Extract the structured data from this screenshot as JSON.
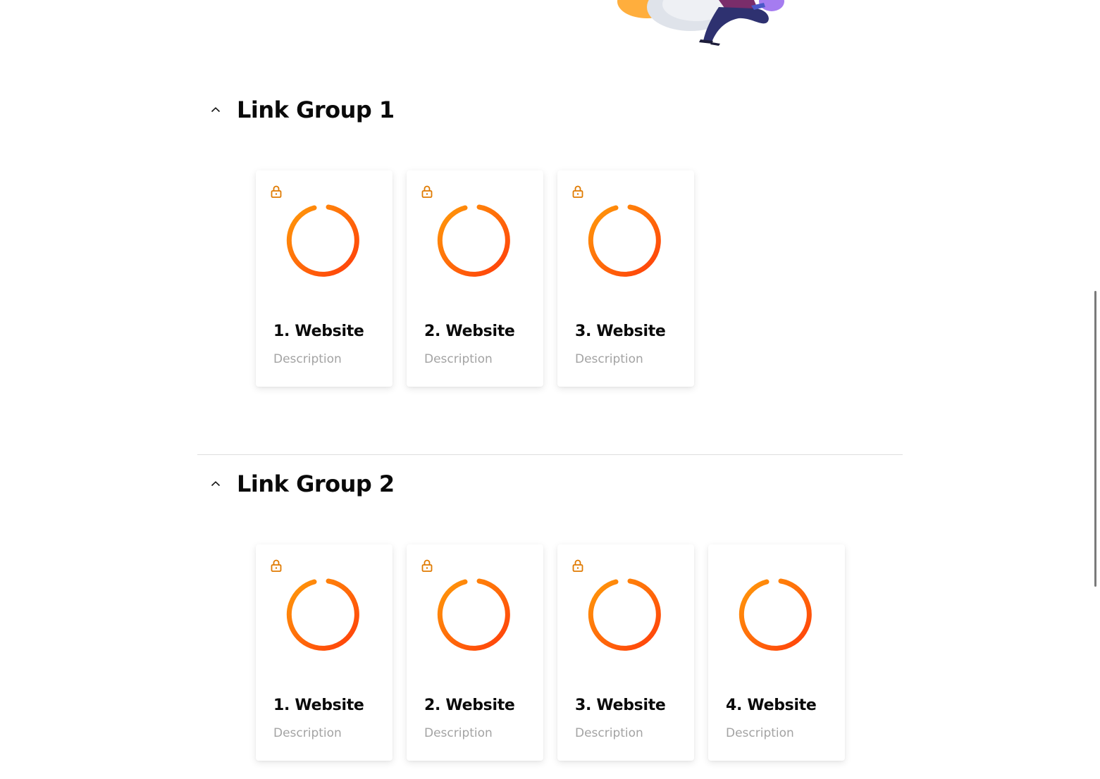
{
  "colors": {
    "accent_start": "#ff9a0a",
    "accent_end": "#ff3d0a",
    "lock": "#e07a00",
    "title": "#0a0a0a",
    "description": "#a3a3a3",
    "divider": "#dedede"
  },
  "illustration": {
    "icon": "person-with-laptop-illustration"
  },
  "groups": [
    {
      "title": "Link Group 1",
      "toggle_icon": "chevron-up-icon",
      "cards": [
        {
          "title": "1. Website",
          "description": "Description",
          "locked": true,
          "icon": "power-icon"
        },
        {
          "title": "2. Website",
          "description": "Description",
          "locked": true,
          "icon": "power-icon"
        },
        {
          "title": "3. Website",
          "description": "Description",
          "locked": true,
          "icon": "power-icon"
        }
      ]
    },
    {
      "title": "Link Group 2",
      "toggle_icon": "chevron-up-icon",
      "cards": [
        {
          "title": "1. Website",
          "description": "Description",
          "locked": true,
          "icon": "power-icon"
        },
        {
          "title": "2. Website",
          "description": "Description",
          "locked": true,
          "icon": "power-icon"
        },
        {
          "title": "3. Website",
          "description": "Description",
          "locked": true,
          "icon": "power-icon"
        },
        {
          "title": "4. Website",
          "description": "Description",
          "locked": false,
          "icon": "power-icon"
        }
      ]
    }
  ]
}
